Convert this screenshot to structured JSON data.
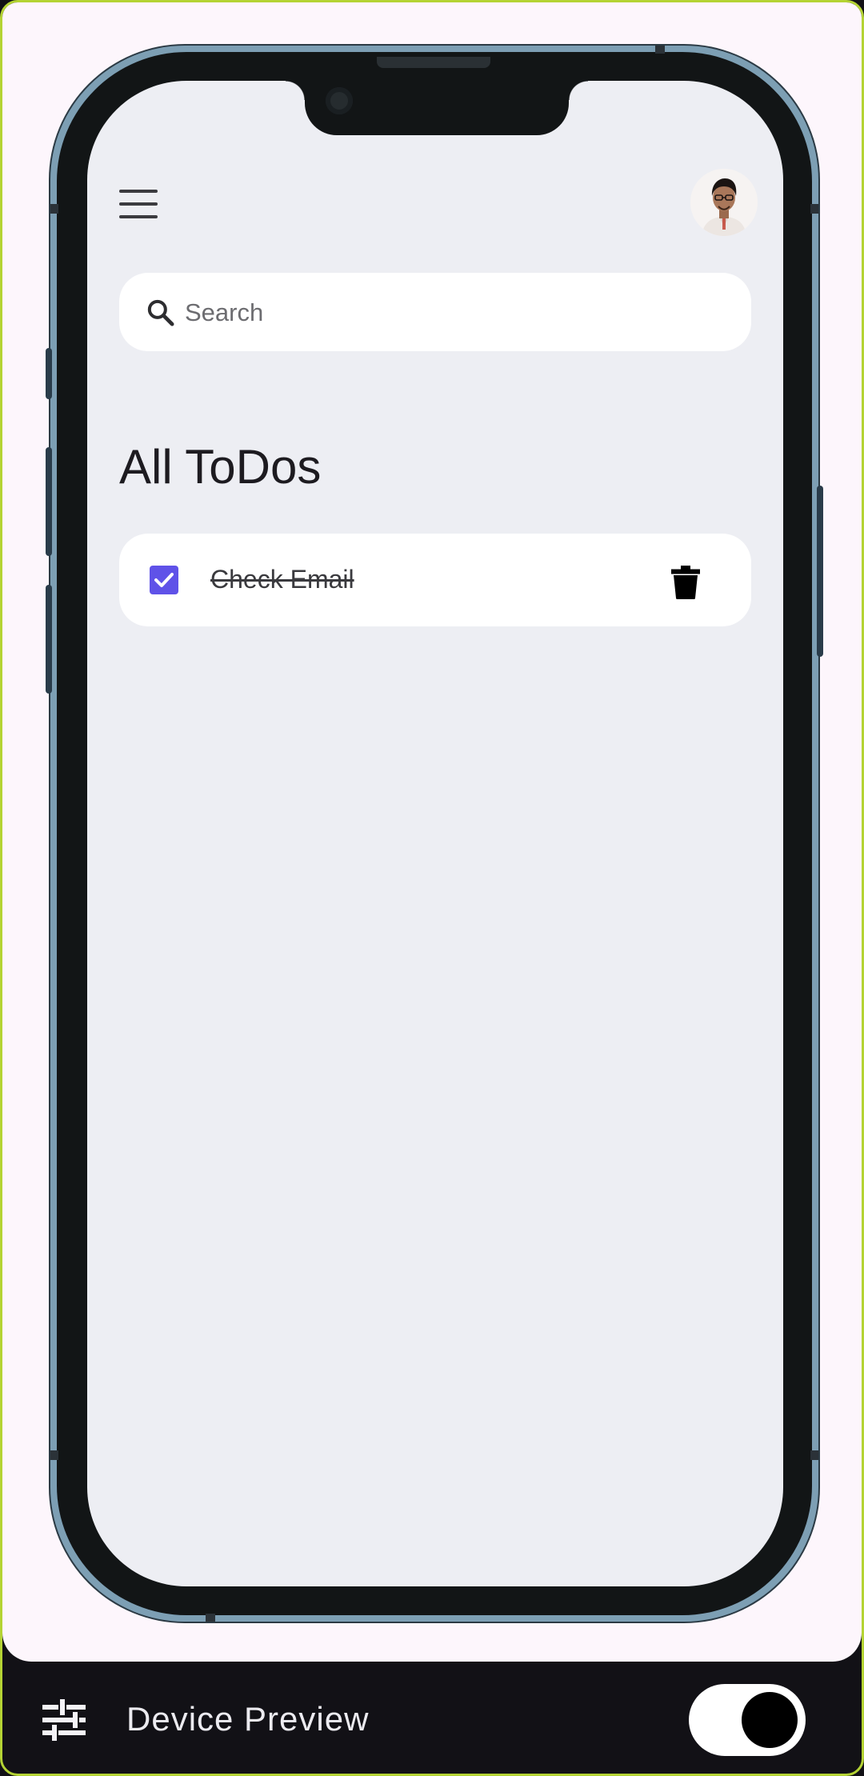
{
  "app": {
    "title": "All ToDos"
  },
  "header": {
    "menu_icon": "hamburger-menu-icon",
    "avatar_icon": "user-avatar-photo"
  },
  "search": {
    "placeholder": "Search",
    "value": "",
    "icon": "search-icon"
  },
  "todos": [
    {
      "text": "Check Email",
      "done": true,
      "delete_icon": "trash-icon"
    }
  ],
  "device_preview": {
    "label": "Device Preview",
    "settings_icon": "tune-sliders-icon",
    "enabled": true
  },
  "colors": {
    "accent": "#5f52e8",
    "screen_background": "#edeef3",
    "frame_accent": "#b4d334",
    "bottom_bar": "#121116"
  }
}
